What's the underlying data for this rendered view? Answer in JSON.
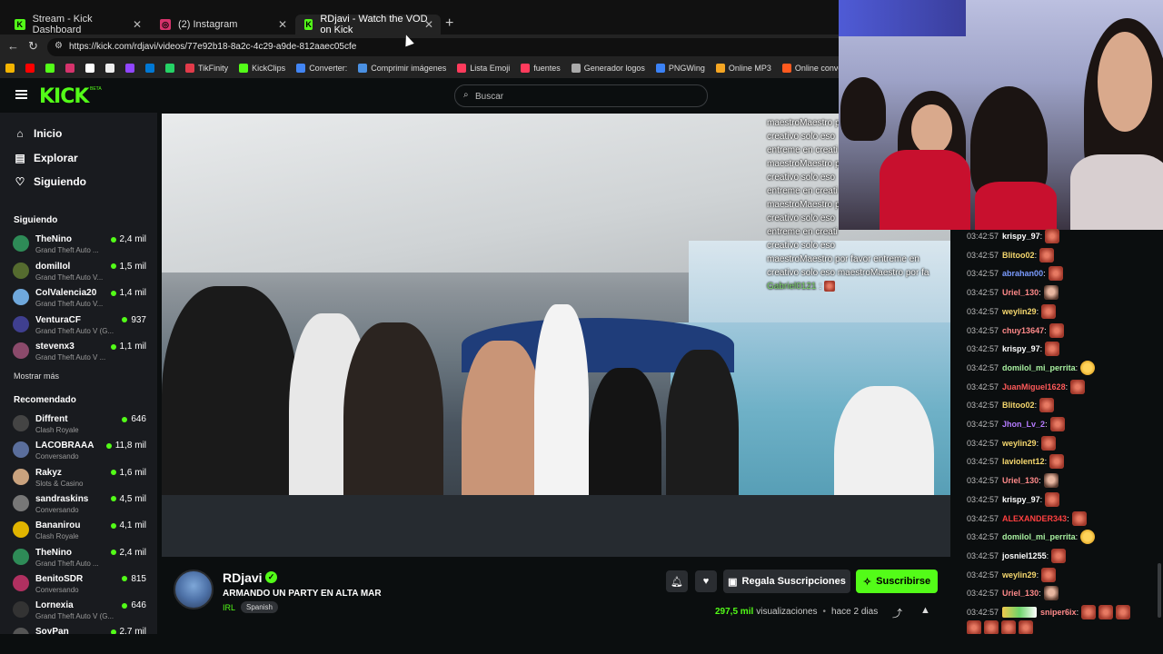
{
  "browser": {
    "tabs": [
      {
        "title": "Stream - Kick Dashboard",
        "icon_color": "#53fc18",
        "icon": "K"
      },
      {
        "title": "(2) Instagram",
        "icon_color": "#d6336c",
        "icon": "◎"
      },
      {
        "title": "RDjavi - Watch the VOD on Kick",
        "icon_color": "#53fc18",
        "icon": "K"
      }
    ],
    "url": "https://kick.com/rdjavi/videos/77e92b18-8a2c-4c29-a9de-812aaec05cfe",
    "bookmarks": [
      {
        "label": "",
        "color": "#f4b400"
      },
      {
        "label": "",
        "color": "#ff0000"
      },
      {
        "label": "",
        "color": "#53fc18"
      },
      {
        "label": "",
        "color": "#d6336c"
      },
      {
        "label": "",
        "color": "#ffffff"
      },
      {
        "label": "",
        "color": "#eeeeee"
      },
      {
        "label": "",
        "color": "#9146ff"
      },
      {
        "label": "",
        "color": "#0078d4"
      },
      {
        "label": "",
        "color": "#25d366"
      },
      {
        "label": "TikFinity",
        "color": "#e23b4a"
      },
      {
        "label": "KickClips",
        "color": "#53fc18"
      },
      {
        "label": "Converter:",
        "color": "#4285f4"
      },
      {
        "label": "Comprimir imágenes",
        "color": "#4a90e2"
      },
      {
        "label": "Lista Emoji",
        "color": "#ff3b5c"
      },
      {
        "label": "fuentes",
        "color": "#ff3b5c"
      },
      {
        "label": "Generador logos",
        "color": "#aaaaaa"
      },
      {
        "label": "PNGWing",
        "color": "#3b82f6"
      },
      {
        "label": "Online MP3",
        "color": "#f5a623"
      },
      {
        "label": "Online converter",
        "color": "#ff5a1f"
      }
    ]
  },
  "header": {
    "logo": "KICK",
    "beta": "BETA",
    "search_placeholder": "Buscar"
  },
  "sidebar": {
    "nav": [
      {
        "label": "Inicio",
        "icon": "⌂"
      },
      {
        "label": "Explorar",
        "icon": "▤"
      },
      {
        "label": "Siguiendo",
        "icon": "♡"
      }
    ],
    "following_title": "Siguiendo",
    "following": [
      {
        "name": "TheNino",
        "game": "Grand Theft Auto ...",
        "viewers": "2,4 mil",
        "color": "#2e8b57"
      },
      {
        "name": "domilIol",
        "game": "Grand Theft Auto V...",
        "viewers": "1,5 mil",
        "color": "#556b2f"
      },
      {
        "name": "ColValencia20",
        "game": "Grand Theft Auto V...",
        "viewers": "1,4 mil",
        "color": "#6fa8dc"
      },
      {
        "name": "VenturaCF",
        "game": "Grand Theft Auto V (G...",
        "viewers": "937",
        "color": "#3f3f8f"
      },
      {
        "name": "stevenx3",
        "game": "Grand Theft Auto V ...",
        "viewers": "1,1 mil",
        "color": "#8b4a6b"
      }
    ],
    "show_more": "Mostrar más",
    "recommended_title": "Recomendado",
    "recommended": [
      {
        "name": "Diffrent",
        "game": "Clash Royale",
        "viewers": "646",
        "color": "#444444"
      },
      {
        "name": "LACOBRAAA",
        "game": "Conversando",
        "viewers": "11,8 mil",
        "color": "#5a6e9c"
      },
      {
        "name": "Rakyz",
        "game": "Slots & Casino",
        "viewers": "1,6 mil",
        "color": "#c9a27e"
      },
      {
        "name": "sandraskins",
        "game": "Conversando",
        "viewers": "4,5 mil",
        "color": "#777777"
      },
      {
        "name": "Bananirou",
        "game": "Clash Royale",
        "viewers": "4,1 mil",
        "color": "#e0b400"
      },
      {
        "name": "TheNino",
        "game": "Grand Theft Auto ...",
        "viewers": "2,4 mil",
        "color": "#2e8b57"
      },
      {
        "name": "BenitoSDR",
        "game": "Conversando",
        "viewers": "815",
        "color": "#b03060"
      },
      {
        "name": "Lornexia",
        "game": "Grand Theft Auto V (G...",
        "viewers": "646",
        "color": "#333333"
      },
      {
        "name": "SoyPan",
        "game": "",
        "viewers": "2,7 mil",
        "color": "#555555"
      }
    ]
  },
  "video": {
    "overlay_chat": [
      "maestroMaestro p",
      "creativo solo eso",
      "entreme en creati",
      "maestroMaestro p",
      "creativo solo eso",
      "entreme en creati",
      "maestroMaestro p",
      "creativo solo eso",
      "entreme en creati",
      "creativo solo eso",
      "maestroMaestro por favor entreme en",
      "creativo solo eso maestroMaestro por fa"
    ],
    "overlay_user": "Gabriel0121",
    "overlay_colon": ":"
  },
  "channel": {
    "name": "RDjavi",
    "verified": "✓",
    "title": "ARMANDO UN PARTY EN ALTA MAR",
    "category": "IRL",
    "language": "Spanish",
    "gift_label": "Regala Suscripciones",
    "subscribe_label": "Suscribirse",
    "views": "297,5 mil",
    "views_label": "visualizaciones",
    "separator": "•",
    "date": "hace 2 dias"
  },
  "chat": {
    "messages": [
      {
        "time": "03:42:57",
        "user": "krispy_97",
        "color": "#ffffff",
        "emote": "red"
      },
      {
        "time": "03:42:57",
        "user": "Blitoo02",
        "color": "#f5d76e",
        "emote": "red"
      },
      {
        "time": "03:42:57",
        "user": "abrahan00",
        "color": "#7b9cff",
        "emote": "red"
      },
      {
        "time": "03:42:57",
        "user": "Uriel_130",
        "color": "#ff8a8a",
        "emote": "face"
      },
      {
        "time": "03:42:57",
        "user": "weylin29",
        "color": "#f5d76e",
        "emote": "red"
      },
      {
        "time": "03:42:57",
        "user": "chuy13647",
        "color": "#ff8a8a",
        "emote": "red"
      },
      {
        "time": "03:42:57",
        "user": "krispy_97",
        "color": "#ffffff",
        "emote": "red"
      },
      {
        "time": "03:42:57",
        "user": "domilol_mi_perrita",
        "color": "#a8f0a0",
        "emote": "lol"
      },
      {
        "time": "03:42:57",
        "user": "JuanMiguel1628",
        "color": "#ff5a5a",
        "emote": "red"
      },
      {
        "time": "03:42:57",
        "user": "Blitoo02",
        "color": "#f5d76e",
        "emote": "red"
      },
      {
        "time": "03:42:57",
        "user": "Jhon_Lv_2",
        "color": "#b57bff",
        "emote": "red"
      },
      {
        "time": "03:42:57",
        "user": "weylin29",
        "color": "#f5d76e",
        "emote": "red"
      },
      {
        "time": "03:42:57",
        "user": "lavioIent12",
        "color": "#f5d76e",
        "emote": "red"
      },
      {
        "time": "03:42:57",
        "user": "Uriel_130",
        "color": "#ff8a8a",
        "emote": "face"
      },
      {
        "time": "03:42:57",
        "user": "krispy_97",
        "color": "#ffffff",
        "emote": "red"
      },
      {
        "time": "03:42:57",
        "user": "ALEXANDER343",
        "color": "#ff4040",
        "emote": "red"
      },
      {
        "time": "03:42:57",
        "user": "domilol_mi_perrita",
        "color": "#a8f0a0",
        "emote": "lol"
      },
      {
        "time": "03:42:57",
        "user": "josniel1255",
        "color": "#ffffff",
        "emote": "red"
      },
      {
        "time": "03:42:57",
        "user": "weylin29",
        "color": "#f5d76e",
        "emote": "red"
      },
      {
        "time": "03:42:57",
        "user": "Uriel_130",
        "color": "#ff8a8a",
        "emote": "face"
      },
      {
        "time": "03:42:57",
        "user": "sniper6ix",
        "color": "#ff8a8a",
        "emote": "red"
      }
    ],
    "colon": ":"
  }
}
